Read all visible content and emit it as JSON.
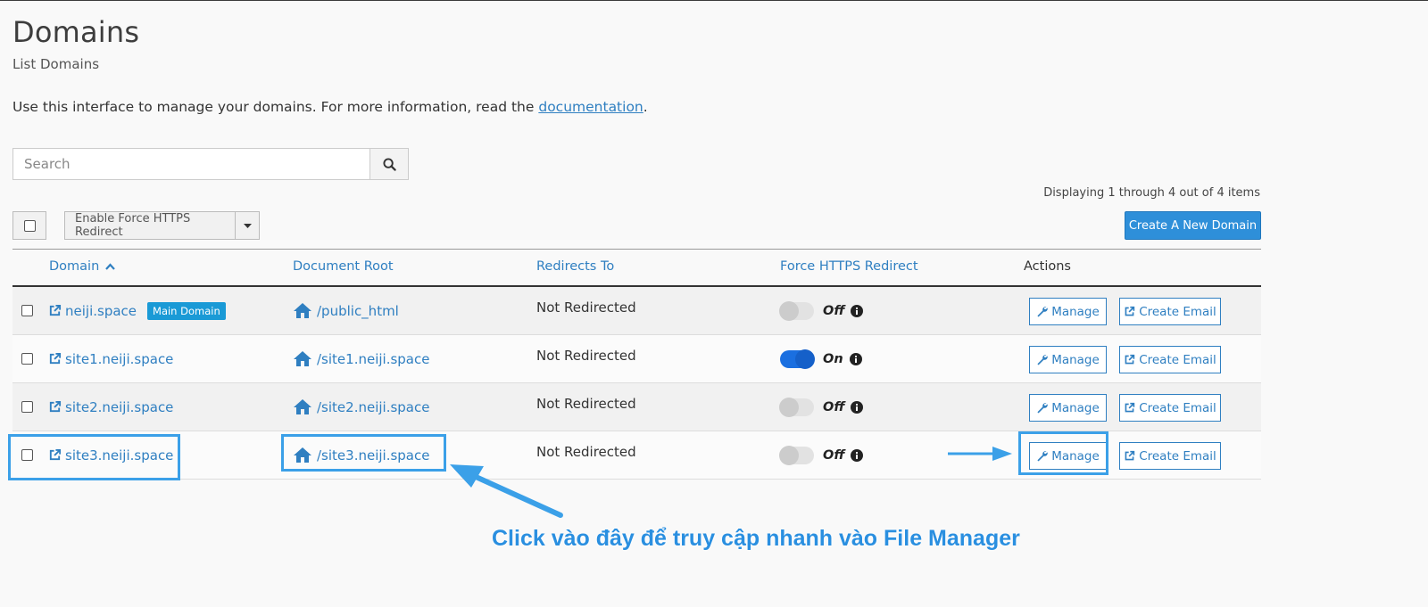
{
  "page": {
    "title": "Domains",
    "subtitle": "List Domains",
    "intro_text": "Use this interface to manage your domains. For more information, read the ",
    "intro_link": "documentation",
    "intro_end": "."
  },
  "search": {
    "placeholder": "Search",
    "icon": "search-icon"
  },
  "pagination": {
    "display_text": "Displaying 1 through 4 out of 4 items"
  },
  "toolbar": {
    "bulk_action_label": "Enable Force HTTPS Redirect",
    "create_label": "Create A New Domain"
  },
  "table": {
    "headers": {
      "domain": "Domain",
      "document_root": "Document Root",
      "redirects_to": "Redirects To",
      "force_https": "Force HTTPS Redirect",
      "actions": "Actions"
    },
    "rows": [
      {
        "domain": "neiji.space",
        "badge": "Main Domain",
        "docroot": "/public_html",
        "redirects": "Not Redirected",
        "https_state": "Off",
        "https_on": false,
        "manage": "Manage",
        "create_email": "Create Email"
      },
      {
        "domain": "site1.neiji.space",
        "badge": "",
        "docroot": "/site1.neiji.space",
        "redirects": "Not Redirected",
        "https_state": "On",
        "https_on": true,
        "manage": "Manage",
        "create_email": "Create Email"
      },
      {
        "domain": "site2.neiji.space",
        "badge": "",
        "docroot": "/site2.neiji.space",
        "redirects": "Not Redirected",
        "https_state": "Off",
        "https_on": false,
        "manage": "Manage",
        "create_email": "Create Email"
      },
      {
        "domain": "site3.neiji.space",
        "badge": "",
        "docroot": "/site3.neiji.space",
        "redirects": "Not Redirected",
        "https_state": "Off",
        "https_on": false,
        "manage": "Manage",
        "create_email": "Create Email"
      }
    ]
  },
  "annotation": {
    "caption": "Click vào đây để truy cập nhanh vào File Manager",
    "color": "#3ba0e8"
  }
}
